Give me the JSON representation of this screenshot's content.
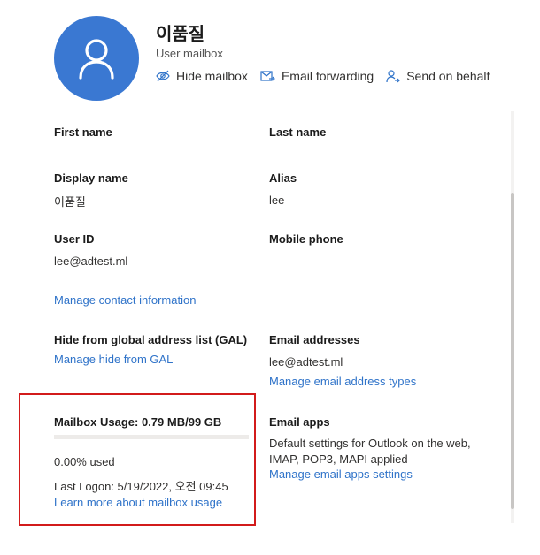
{
  "header": {
    "name": "이품질",
    "type": "User mailbox",
    "actions": [
      {
        "label": "Hide mailbox",
        "icon": "hide-eye-icon"
      },
      {
        "label": "Email forwarding",
        "icon": "mail-forward-icon"
      },
      {
        "label": "Send on behalf",
        "icon": "person-arrow-icon"
      }
    ]
  },
  "fields": {
    "first_name": {
      "label": "First name",
      "value": ""
    },
    "last_name": {
      "label": "Last name",
      "value": ""
    },
    "display_name": {
      "label": "Display name",
      "value": "이품질"
    },
    "alias": {
      "label": "Alias",
      "value": "lee"
    },
    "user_id": {
      "label": "User ID",
      "value": "lee@adtest.ml"
    },
    "mobile_phone": {
      "label": "Mobile phone",
      "value": ""
    },
    "manage_contact": "Manage contact information",
    "gal": {
      "label": "Hide from global address list (GAL)",
      "link": "Manage hide from GAL"
    },
    "email_addresses": {
      "label": "Email addresses",
      "value": "lee@adtest.ml",
      "link": "Manage email address types"
    },
    "mailbox_usage": {
      "label": "Mailbox Usage: 0.79 MB/99 GB",
      "percent_used": 0.0,
      "used_text": "0.00% used",
      "last_logon": "Last Logon: 5/19/2022, 오전 09:45",
      "link": "Learn more about mailbox usage"
    },
    "email_apps": {
      "label": "Email apps",
      "desc": "Default settings for Outlook on the web, IMAP, POP3, MAPI applied",
      "link": "Manage email apps settings"
    }
  },
  "colors": {
    "accent": "#3a78d2",
    "link": "#2f73c9",
    "highlight": "#d21b1b"
  }
}
